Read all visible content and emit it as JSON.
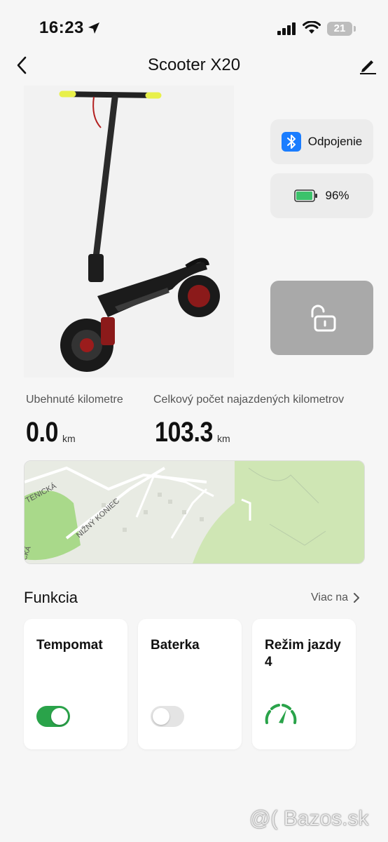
{
  "status_bar": {
    "time": "16:23",
    "battery_level": "21"
  },
  "nav": {
    "title": "Scooter X20",
    "back_icon": "chevron-left-icon",
    "edit_icon": "pencil-icon"
  },
  "connection": {
    "label": "Odpojenie",
    "icon": "bluetooth-icon",
    "accent": "#1a7dff"
  },
  "battery": {
    "label": "96%",
    "level": 0.96,
    "color": "#3cc26b"
  },
  "lock": {
    "icon": "unlock-icon",
    "state": "unlocked"
  },
  "stats": {
    "trip_label": "Ubehnuté kilometre",
    "trip_value": "0.0",
    "trip_unit": "km",
    "total_label": "Celkový počet najazdených kilometrov",
    "total_value": "103.3",
    "total_unit": "km"
  },
  "map": {
    "labels": [
      "TENICKÁ",
      "NIŽNÝ KONIEC",
      "CKÁ"
    ]
  },
  "functions": {
    "title": "Funkcia",
    "more_label": "Viac na",
    "items": [
      {
        "title": "Tempomat",
        "control": "toggle",
        "on": true
      },
      {
        "title": "Baterka",
        "control": "toggle",
        "on": false
      },
      {
        "title": "Režim jazdy 4",
        "control": "gauge-icon"
      }
    ],
    "accent": "#2aa34a"
  },
  "watermark": "@( Bazos.sk"
}
